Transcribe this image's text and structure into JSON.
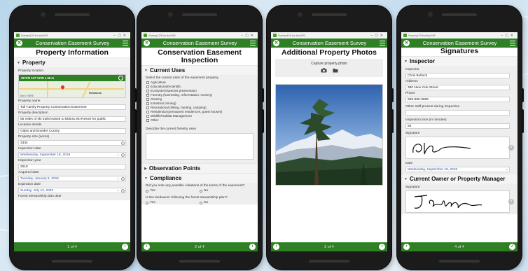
{
  "app": {
    "window_title": "Survey123 for ArcGIS",
    "survey_title": "Conservation Easement Survey"
  },
  "screen1": {
    "page_title": "Property Information",
    "group_header": "Property",
    "map": {
      "label": "Property location",
      "coords": "39°5'N 117°13'W ± 65 m",
      "town": "Redlands",
      "attribution": "Esri • HERE"
    },
    "fields": [
      {
        "label": "Property name",
        "value": "Toll Family Property Conservation Easement"
      },
      {
        "label": "Property description",
        "value": "65 miles of ski trails leased to Eldora Ski Resort for public"
      },
      {
        "label": "Location details",
        "value": "Gilpin and Boulder County"
      },
      {
        "label": "Property size (acres)",
        "value": "3334"
      },
      {
        "label": "Inspection date",
        "value": "Wednesday, September 18, 2019"
      },
      {
        "label": "Inspection year",
        "value": "2019"
      },
      {
        "label": "Acquired date",
        "value": "Tuesday, January 6, 2015"
      },
      {
        "label": "Expiration date",
        "value": "Sunday, July 12, 2020"
      }
    ],
    "cut_label": "Forest stewardship plan date",
    "page_indicator": "1 of 4"
  },
  "screen2": {
    "page_title": "Conservation Easement Inspection",
    "group_current_uses": "Current Uses",
    "intro": "Select the current uses of the easement property",
    "uses": [
      {
        "label": "Agriculture",
        "checked": false
      },
      {
        "label": "Educational/Scientific",
        "checked": false
      },
      {
        "label": "Ecosystem/species preservation",
        "checked": false
      },
      {
        "label": "Forestry (harvesting, reforestation, nursery)",
        "checked": true
      },
      {
        "label": "Grazing",
        "checked": false
      },
      {
        "label": "Industrial (mining)",
        "checked": false
      },
      {
        "label": "Recreational (hiking, hunting, camping)",
        "checked": false
      },
      {
        "label": "Residential (permanent residences, guest houses)",
        "checked": false
      },
      {
        "label": "Wildlife/Habitat Management",
        "checked": false
      },
      {
        "label": "Other",
        "checked": false
      }
    ],
    "forestry_label": "Describe the current forestry uses",
    "group_observation": "Observation Points",
    "group_compliance": "Compliance",
    "q1": "Did you note any possible violations of the terms of the easement?",
    "q2": "Is the landowner following the forest stewardship plan?",
    "yes": "Yes",
    "no": "No",
    "page_indicator": "2 of 4"
  },
  "screen3": {
    "page_title": "Additional Property Photos",
    "capture_label": "Capture property photo",
    "page_indicator": "3 of 4"
  },
  "screen4": {
    "page_title": "Signatures",
    "group_inspector": "Inspector",
    "fields": [
      {
        "label": "Inspector",
        "value": "Chris Bullock"
      },
      {
        "label": "Address",
        "value": "380 New York Street"
      },
      {
        "label": "Phone",
        "value": "999-999-9999"
      },
      {
        "label": "Other staff present during inspection",
        "value": ""
      },
      {
        "label": "Inspection time (in minutes)",
        "value": "50"
      }
    ],
    "signature_label": "Signature",
    "date_label": "Date",
    "date_value": "Wednesday, September 18, 2019",
    "group_owner": "Current Owner or Property Manager",
    "owner_signature_label": "Signature",
    "page_indicator": "4 of 4"
  },
  "colors": {
    "brand_green": "#2f7f25",
    "date_blue": "#2b4fa8"
  },
  "icons": [
    "close-icon",
    "menu-icon",
    "prev-icon",
    "next-icon",
    "camera-icon",
    "folder-icon",
    "submit-check-icon",
    "clear-icon",
    "gps-icon"
  ]
}
